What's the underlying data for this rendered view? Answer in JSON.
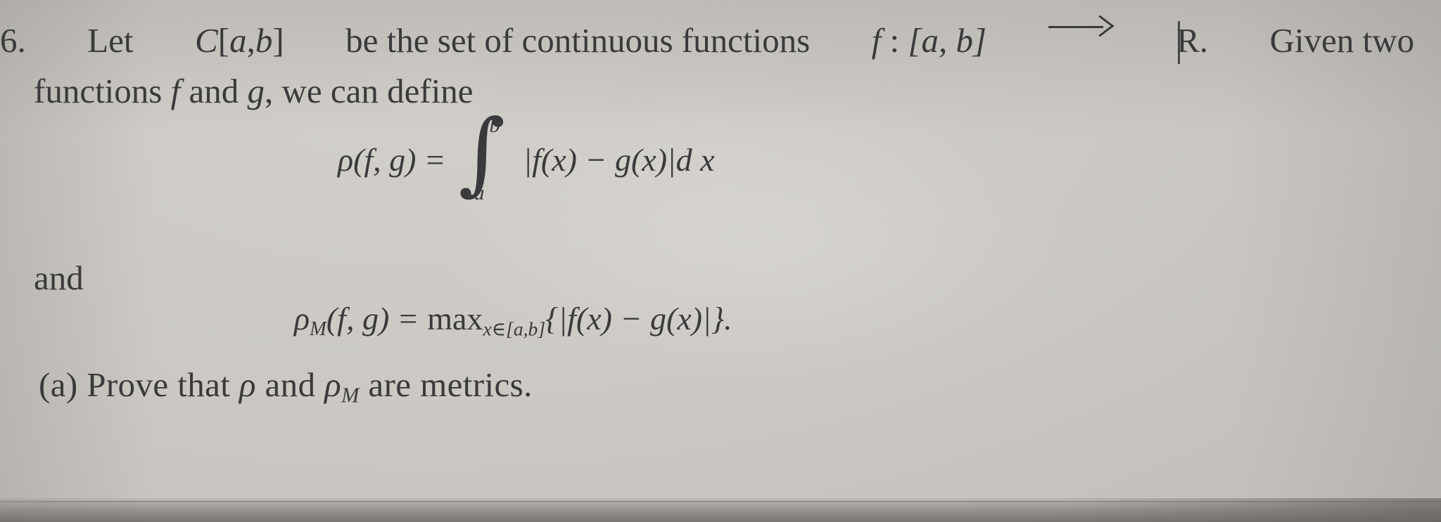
{
  "document": {
    "type": "textbook-problem-photo",
    "problem_number": "6.",
    "background_color": "#c9c6c1",
    "text_color": "#3a3a3c"
  },
  "problem": {
    "number_label": "6.",
    "statement_line1_left": "Let",
    "statement_set": "C[a, b]",
    "statement_line1_mid": "be the set of continuous functions",
    "function_decl": "f : [a, b]",
    "arrow": "⟶",
    "codomain": "R",
    "codomain_period": ".",
    "statement_line1_end": "Given two",
    "statement_line2": "functions f and g, we can define",
    "connector": "and",
    "part_a_label": "(a)",
    "part_a_text": "Prove that ρ and ρM are metrics."
  },
  "part_a_pieces": {
    "label": "(a)",
    "prove_that": "Prove that",
    "rho": "ρ",
    "and": "and",
    "rho_m_base": "ρ",
    "rho_m_sub": "M",
    "are_metrics": "are metrics."
  },
  "line1_pieces": {
    "num": "6.",
    "let": "Let",
    "C": "C",
    "bracket_ab_open": "[",
    "a": "a",
    "comma": ",",
    "b": "b",
    "bracket_ab_close": "]",
    "be_the_set_of": "be  the  set  of  continuous  functions",
    "f": "f",
    "colon": ":",
    "interval": "[a, b]",
    "R": "R",
    "period": ".",
    "given_two": "Given  two"
  },
  "line2_pieces": {
    "functions": "functions",
    "f": "f",
    "and": "and",
    "g": "g",
    "comma_we_can_define": ", we can define"
  },
  "equation1": {
    "lhs": "ρ(f, g)",
    "equals": "=",
    "integral_glyph": "∫",
    "limit_upper": "b",
    "limit_lower": "a",
    "integrand": "|f(x) − g(x)|d x",
    "full_latex": "\\rho(f,g) = \\int_a^b |f(x) - g(x)|\\,dx"
  },
  "equation2": {
    "lhs_base": "ρ",
    "lhs_sub": "M",
    "lhs_args": "(f, g)",
    "equals": "=",
    "operator": "max",
    "operator_sub": "x∈[a,b]",
    "body": "{|f(x) − g(x)|}.",
    "full_latex": "\\rho_M(f,g) = \\max_{x\\in[a,b]}\\{|f(x)-g(x)|\\}."
  }
}
